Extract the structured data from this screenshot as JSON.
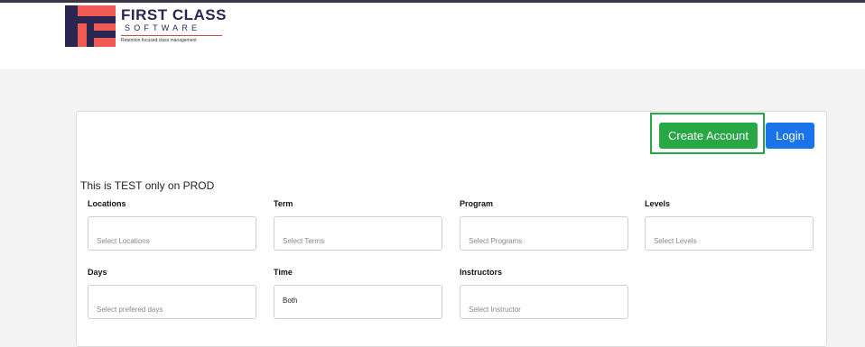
{
  "brand": {
    "title": "FIRST CLASS",
    "subtitle": "SOFTWARE",
    "tagline": "Retention focused class management",
    "colors": {
      "navy": "#2b2651",
      "coral": "#f05a55",
      "accent_red": "#d14848"
    }
  },
  "header": {
    "create_account_label": "Create Account",
    "login_label": "Login",
    "colors": {
      "create": "#28a745",
      "login": "#1a73e8"
    }
  },
  "notice": "This is TEST only on PROD",
  "filters": {
    "locations": {
      "label": "Locations",
      "placeholder": "Select Locations"
    },
    "term": {
      "label": "Term",
      "placeholder": "Select Terms"
    },
    "program": {
      "label": "Program",
      "placeholder": "Select Programs"
    },
    "levels": {
      "label": "Levels",
      "placeholder": "Select Levels"
    },
    "days": {
      "label": "Days",
      "placeholder": "Select prefered days"
    },
    "time": {
      "label": "Time",
      "value": "Both"
    },
    "instructors": {
      "label": "Instructors",
      "placeholder": "Select Instructor"
    }
  }
}
